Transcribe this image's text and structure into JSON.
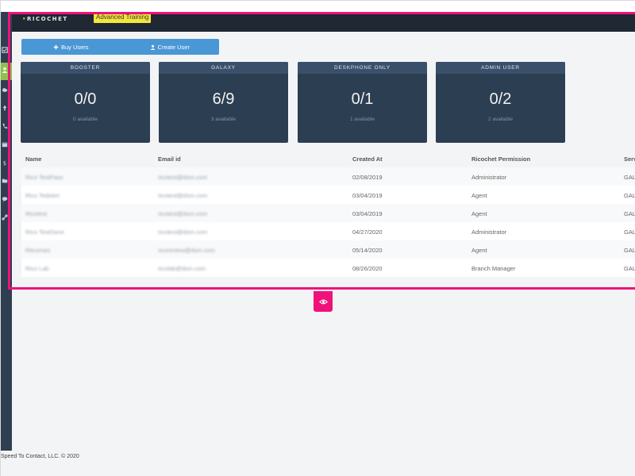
{
  "app": {
    "logo": "RICOCHET",
    "logo_mark": "•",
    "training_badge": "Advanced Training"
  },
  "actions": {
    "buy_users": "Buy Users",
    "create_user": "Create User"
  },
  "cards": [
    {
      "title": "BOOSTER",
      "value": "0/0",
      "sub": "0 available"
    },
    {
      "title": "GALAXY",
      "value": "6/9",
      "sub": "3 available"
    },
    {
      "title": "DESKPHONE ONLY",
      "value": "0/1",
      "sub": "1 available"
    },
    {
      "title": "ADMIN USER",
      "value": "0/2",
      "sub": "2 available"
    }
  ],
  "table": {
    "headers": [
      "Name",
      "Email id",
      "Created At",
      "Ricochet Permission",
      "Serv"
    ],
    "rows": [
      {
        "name": "Rico TestPass",
        "email": "ricotest@dsm.com",
        "created": "02/08/2019",
        "permission": "Administrator",
        "server": "GAL"
      },
      {
        "name": "Rico Tedsten",
        "email": "ricotest@dsm.com",
        "created": "03/04/2019",
        "permission": "Agent",
        "server": "GAL"
      },
      {
        "name": "Ricotest",
        "email": "ricotest@dsm.com",
        "created": "03/04/2019",
        "permission": "Agent",
        "server": "GAL"
      },
      {
        "name": "Rico TestDone",
        "email": "ricotest@dsm.com",
        "created": "04/27/2020",
        "permission": "Administrator",
        "server": "GAL"
      },
      {
        "name": "Ritcomes",
        "email": "ricoreview@dsm.com",
        "created": "05/14/2020",
        "permission": "Agent",
        "server": "GAL"
      },
      {
        "name": "Rico Lab",
        "email": "ricolab@dsm.com",
        "created": "08/26/2020",
        "permission": "Branch Manager",
        "server": "GAL"
      }
    ]
  },
  "footer": "Speed To Contact, LLC. © 2020",
  "colors": {
    "highlight": "#f0127b",
    "badge": "#f5e63c",
    "button": "#4a97d6",
    "card": "#2c3e52",
    "sidebar_active": "#8bc34a"
  }
}
